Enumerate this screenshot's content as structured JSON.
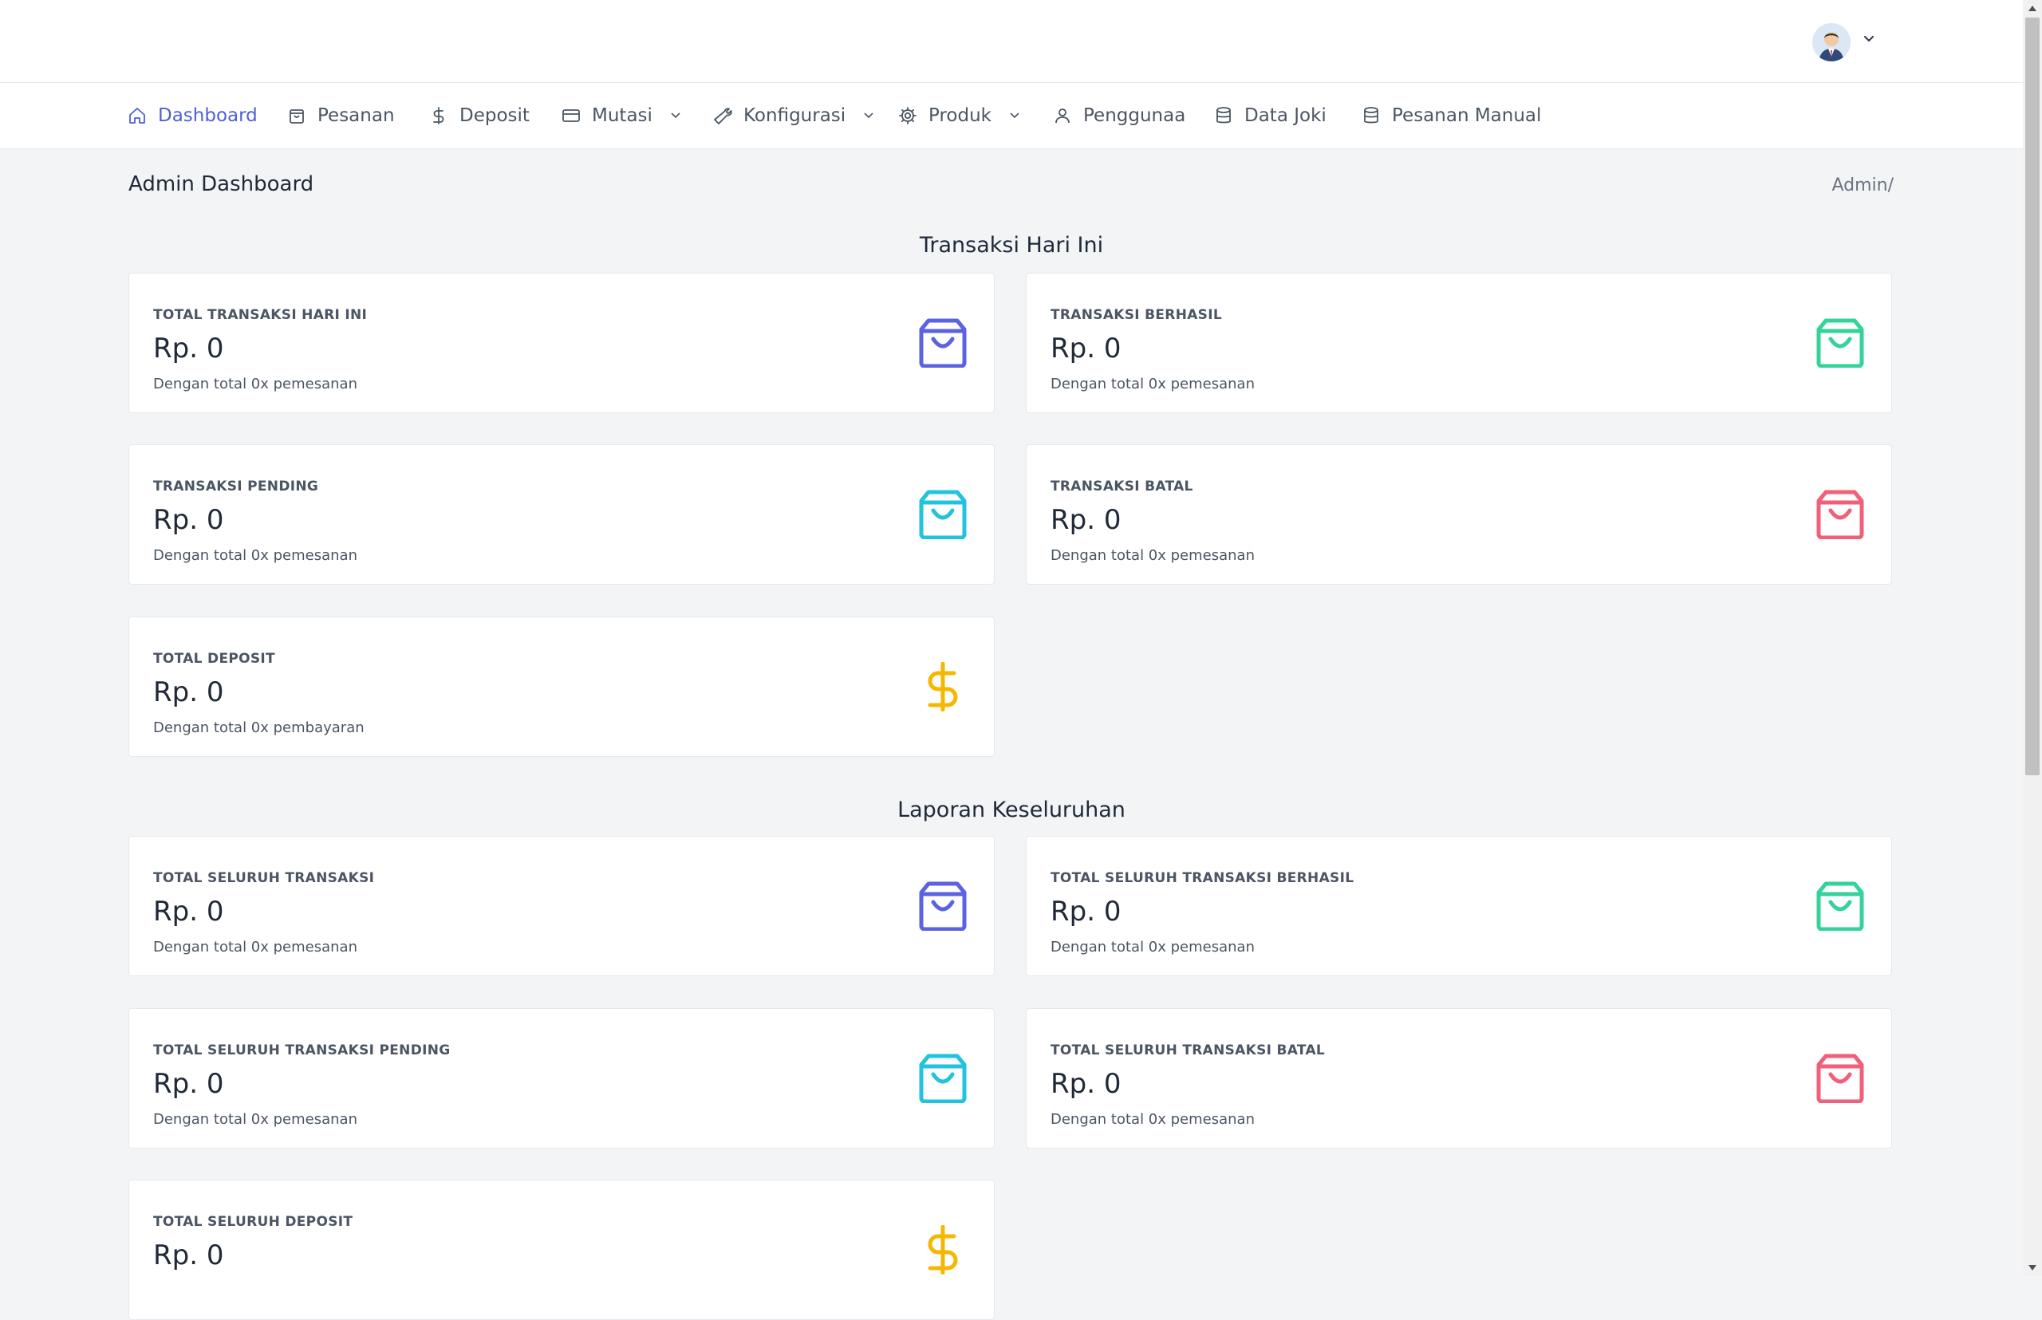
{
  "nav": {
    "items": [
      {
        "label": "Dashboard",
        "icon": "home-icon",
        "active": true
      },
      {
        "label": "Pesanan",
        "icon": "bag-icon"
      },
      {
        "label": "Deposit",
        "icon": "dollar-icon"
      },
      {
        "label": "Mutasi",
        "icon": "card-icon",
        "dropdown": true
      },
      {
        "label": "Konfigurasi",
        "icon": "wrench-icon",
        "dropdown": true
      },
      {
        "label": "Produk",
        "icon": "gear-icon",
        "dropdown": true
      },
      {
        "label": "Penggunaa",
        "icon": "user-icon"
      },
      {
        "label": "Data Joki",
        "icon": "database-icon"
      },
      {
        "label": "Pesanan Manual",
        "icon": "database-icon"
      }
    ]
  },
  "page": {
    "title": "Admin Dashboard",
    "breadcrumb": "Admin/"
  },
  "sections": {
    "today": {
      "title": "Transaksi Hari Ini",
      "cards": [
        {
          "label": "TOTAL TRANSAKSI HARI INI",
          "value": "Rp. 0",
          "sub": "Dengan total 0x pemesanan",
          "icon": "shopping-bag-icon",
          "color": "#5b63e0"
        },
        {
          "label": "TRANSAKSI BERHASIL",
          "value": "Rp. 0",
          "sub": "Dengan total 0x pemesanan",
          "icon": "shopping-bag-icon",
          "color": "#34d399"
        },
        {
          "label": "TRANSAKSI PENDING",
          "value": "Rp. 0",
          "sub": "Dengan total 0x pemesanan",
          "icon": "shopping-bag-icon",
          "color": "#22c3dc"
        },
        {
          "label": "TRANSAKSI BATAL",
          "value": "Rp. 0",
          "sub": "Dengan total 0x pemesanan",
          "icon": "shopping-bag-icon",
          "color": "#f25f7a"
        },
        {
          "label": "TOTAL DEPOSIT",
          "value": "Rp. 0",
          "sub": "Dengan total 0x pembayaran",
          "icon": "dollar-icon",
          "color": "#f5b800"
        }
      ]
    },
    "overall": {
      "title": "Laporan Keseluruhan",
      "cards": [
        {
          "label": "TOTAL SELURUH TRANSAKSI",
          "value": "Rp. 0",
          "sub": "Dengan total 0x pemesanan",
          "icon": "shopping-bag-icon",
          "color": "#5b63e0"
        },
        {
          "label": "TOTAL SELURUH TRANSAKSI BERHASIL",
          "value": "Rp. 0",
          "sub": "Dengan total 0x pemesanan",
          "icon": "shopping-bag-icon",
          "color": "#34d399"
        },
        {
          "label": "TOTAL SELURUH TRANSAKSI PENDING",
          "value": "Rp. 0",
          "sub": "Dengan total 0x pemesanan",
          "icon": "shopping-bag-icon",
          "color": "#22c3dc"
        },
        {
          "label": "TOTAL SELURUH TRANSAKSI BATAL",
          "value": "Rp. 0",
          "sub": "Dengan total 0x pemesanan",
          "icon": "shopping-bag-icon",
          "color": "#f25f7a"
        },
        {
          "label": "TOTAL SELURUH DEPOSIT",
          "value": "Rp. 0",
          "sub": "",
          "icon": "dollar-icon",
          "color": "#f5b800"
        }
      ]
    }
  }
}
